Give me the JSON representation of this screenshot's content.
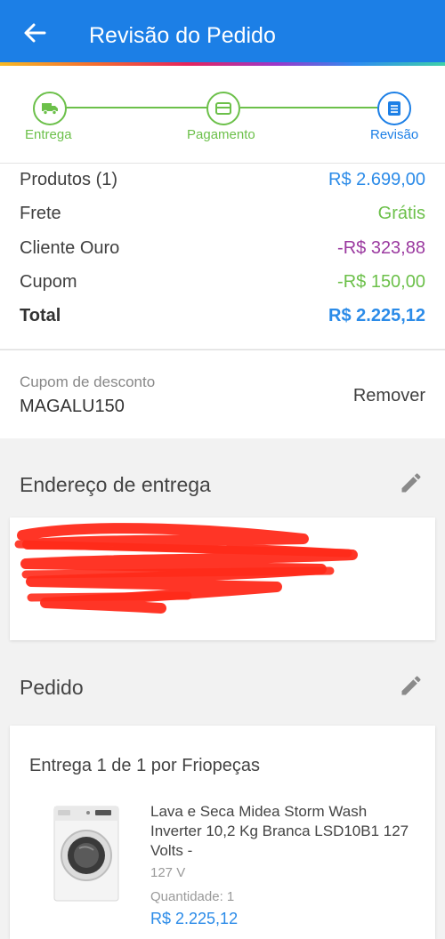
{
  "header": {
    "title": "Revisão do Pedido"
  },
  "stepper": {
    "steps": [
      {
        "label": "Entrega",
        "state": "done"
      },
      {
        "label": "Pagamento",
        "state": "done"
      },
      {
        "label": "Revisão",
        "state": "active"
      }
    ]
  },
  "summary": {
    "rows": [
      {
        "label": "Produtos (1)",
        "value": "R$ 2.699,00"
      },
      {
        "label": "Frete",
        "value": "Grátis"
      },
      {
        "label": "Cliente Ouro",
        "value": "-R$ 323,88"
      },
      {
        "label": "Cupom",
        "value": "-R$ 150,00"
      },
      {
        "label": "Total",
        "value": "R$ 2.225,12"
      }
    ]
  },
  "coupon": {
    "label": "Cupom de desconto",
    "code": "MAGALU150",
    "remove_label": "Remover"
  },
  "address_section": {
    "title": "Endereço de entrega"
  },
  "order_section": {
    "title": "Pedido",
    "delivery_title": "Entrega 1 de 1 por Friopeças",
    "product": {
      "name": "Lava e Seca Midea Storm Wash Inverter 10,2 Kg Branca LSD10B1 127 Volts -",
      "voltage": "127 V",
      "quantity": "Quantidade:  1",
      "price": "R$ 2.225,12"
    }
  },
  "colors": {
    "primary": "#1c7fe6",
    "step_done": "#6cc04a",
    "discount_purple": "#9b3aa0",
    "redaction": "#ff2a1a"
  },
  "icons": {
    "back": "arrow-left-icon",
    "step1": "truck-icon",
    "step2": "credit-card-icon",
    "step3": "list-document-icon",
    "edit": "pencil-icon"
  }
}
